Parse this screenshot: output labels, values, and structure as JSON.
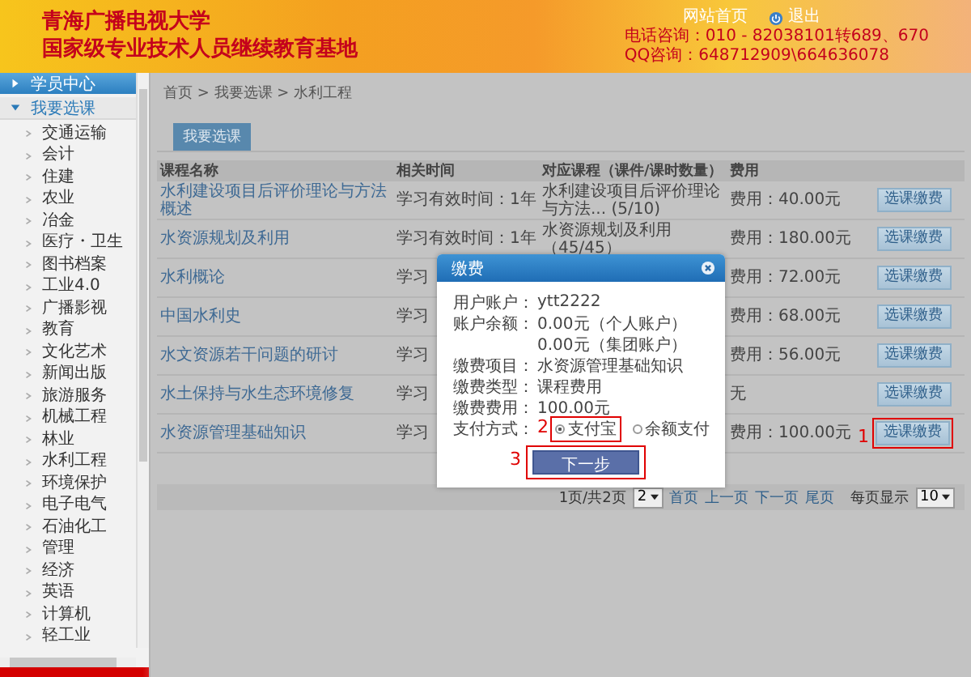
{
  "header": {
    "title_lines": [
      "青海广播电视大学",
      "国家级专业技术人员继续教育基地"
    ],
    "links": [
      {
        "label": "网站首页",
        "kind": "home"
      },
      {
        "label": "退出",
        "kind": "logout"
      }
    ],
    "phone": "电话咨询：010 - 82038101转689、670",
    "qq": "QQ咨询：648712909\\664636078"
  },
  "sidebar": {
    "sections": [
      {
        "label": "学员中心",
        "expanded": false
      },
      {
        "label": "我要选课",
        "expanded": true,
        "children": [
          {
            "label": "交通运输"
          },
          {
            "label": "会计"
          },
          {
            "label": "住建"
          },
          {
            "label": "农业"
          },
          {
            "label": "冶金"
          },
          {
            "label": "医疗・卫生"
          },
          {
            "label": "图书档案"
          },
          {
            "label": "工业4.0"
          },
          {
            "label": "广播影视"
          },
          {
            "label": "教育"
          },
          {
            "label": "文化艺术"
          },
          {
            "label": "新闻出版"
          },
          {
            "label": "旅游服务"
          },
          {
            "label": "机械工程"
          },
          {
            "label": "林业"
          },
          {
            "label": "水利工程"
          },
          {
            "label": "环境保护"
          },
          {
            "label": "电子电气"
          },
          {
            "label": "石油化工"
          },
          {
            "label": "管理"
          },
          {
            "label": "经济"
          },
          {
            "label": "英语"
          },
          {
            "label": "计算机"
          },
          {
            "label": "轻工业"
          }
        ]
      }
    ]
  },
  "breadcrumb": "首页 > 我要选课 > 水利工程",
  "tabs": [
    {
      "label": "我要选课",
      "selected": true
    }
  ],
  "table": {
    "columns": [
      "课程名称",
      "相关时间",
      "对应课程（课件/课时数量）",
      "费用"
    ],
    "rows": [
      {
        "name": "水利建设项目后评价理论与方法概述",
        "time": "学习有效时间：1年",
        "course": "水利建设项目后评价理论与方法... (5/10)",
        "fee": "费用：40.00元",
        "button": "选课缴费"
      },
      {
        "name": "水资源规划及利用",
        "time": "学习有效时间：1年",
        "course": "水资源规划及利用（45/45）",
        "fee": "费用：180.00元",
        "button": "选课缴费"
      },
      {
        "name": "水利概论",
        "time": "学习",
        "fee": "费用：72.00元",
        "button": "选课缴费"
      },
      {
        "name": "中国水利史",
        "time": "学习",
        "fee": "费用：68.00元",
        "button": "选课缴费"
      },
      {
        "name": "水文资源若干问题的研讨",
        "time": "学习",
        "fee": "费用：56.00元",
        "button": "选课缴费"
      },
      {
        "name": "水土保持与水生态环境修复",
        "time": "学习",
        "fee": "无",
        "button": "选课缴费"
      },
      {
        "name": "水资源管理基础知识",
        "time": "学习",
        "fee": "费用：100.00元",
        "button": "选课缴费",
        "callout": "1"
      }
    ]
  },
  "pagination": {
    "page_info": "1页/共2页",
    "page_select": "2",
    "links": [
      "首页",
      "上一页",
      "下一页",
      "尾页"
    ],
    "per_page_label": "每页显示",
    "per_page_select": "10"
  },
  "dialog": {
    "title": "缴费",
    "fields": [
      {
        "label": "用户账户：",
        "value": "ytt2222"
      },
      {
        "label": "账户余额：",
        "value": "0.00元（个人账户）"
      },
      {
        "value": "0.00元（集团账户）"
      },
      {
        "label": "缴费项目：",
        "value": "水资源管理基础知识"
      },
      {
        "label": "缴费类型：",
        "value": "课程费用"
      },
      {
        "label": "缴费费用：",
        "value": "100.00元"
      }
    ],
    "payment": {
      "label": "支付方式：",
      "options": [
        {
          "label": "支付宝",
          "selected": true,
          "callout": "2"
        },
        {
          "label": "余额支付",
          "selected": false
        }
      ]
    },
    "next_button": {
      "label": "下一步",
      "callout": "3"
    }
  }
}
